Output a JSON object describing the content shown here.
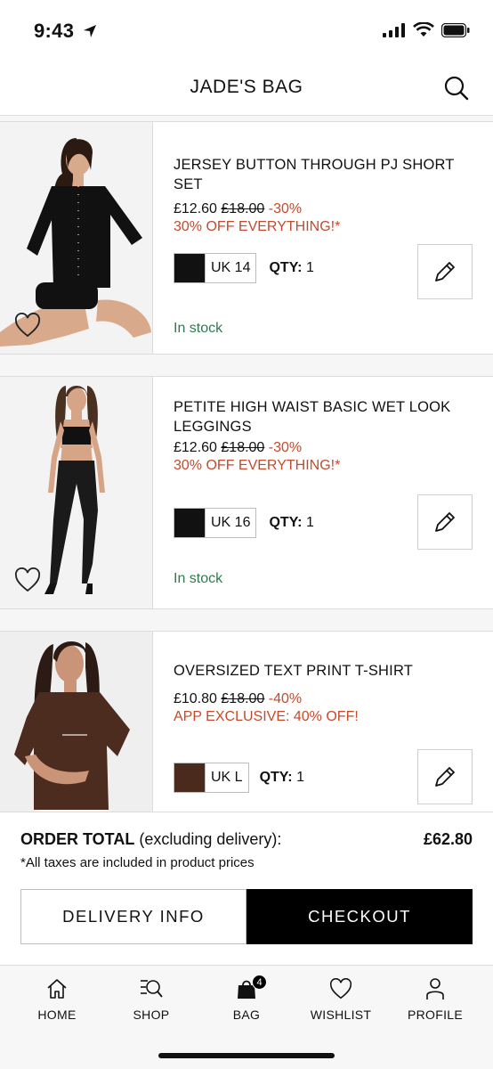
{
  "status": {
    "time": "9:43"
  },
  "header": {
    "title": "JADE'S BAG"
  },
  "items": [
    {
      "title": "JERSEY BUTTON THROUGH PJ SHORT SET",
      "price": "£12.60",
      "old_price": "£18.00",
      "discount": "-30%",
      "promo": "30% OFF EVERYTHING!*",
      "size": "UK 14",
      "qty_label": "QTY:",
      "qty": "1",
      "swatch_color": "#111111",
      "stock": "In stock"
    },
    {
      "title": "PETITE HIGH WAIST BASIC WET LOOK LEGGINGS",
      "price": "£12.60",
      "old_price": "£18.00",
      "discount": "-30%",
      "promo": "30% OFF EVERYTHING!*",
      "size": "UK 16",
      "qty_label": "QTY:",
      "qty": "1",
      "swatch_color": "#111111",
      "stock": "In stock"
    },
    {
      "title": "OVERSIZED TEXT PRINT T-SHIRT",
      "price": "£10.80",
      "old_price": "£18.00",
      "discount": "-40%",
      "promo": "APP EXCLUSIVE: 40% OFF!",
      "size": "UK L",
      "qty_label": "QTY:",
      "qty": "1",
      "swatch_color": "#4a2a1c"
    }
  ],
  "order": {
    "total_label_bold": "ORDER TOTAL",
    "total_label_rest": "(excluding delivery):",
    "total_value": "£62.80",
    "tax_note": "*All taxes are included in product prices",
    "delivery_button": "DELIVERY INFO",
    "checkout_button": "CHECKOUT"
  },
  "tabs": [
    {
      "label": "HOME",
      "icon": "home-icon"
    },
    {
      "label": "SHOP",
      "icon": "shop-search-icon"
    },
    {
      "label": "BAG",
      "icon": "bag-icon",
      "badge": "4"
    },
    {
      "label": "WISHLIST",
      "icon": "heart-icon"
    },
    {
      "label": "PROFILE",
      "icon": "profile-icon"
    }
  ],
  "colors": {
    "discount": "#c44a2c",
    "in_stock": "#2e7a4e",
    "checkout_bg": "#000000"
  }
}
